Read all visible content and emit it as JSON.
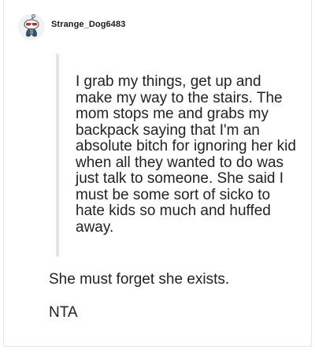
{
  "comment": {
    "username": "Strange_Dog6483",
    "avatar_icon": "reddit-snoo-avatar-icon",
    "quote": "I grab my things, get up and make my way to the stairs. The mom stops me and grabs my backpack saying that I'm an absolute bitch for ignoring her kid when all they wanted to do was just talk to someone. She said I must be some sort of sicko to hate kids so much and huffed away.",
    "paragraphs": [
      "She must forget she exists.",
      "NTA"
    ]
  },
  "colors": {
    "quote_bar": "#e5e5e5",
    "card_border": "#e4e4e4",
    "text": "#222222"
  }
}
